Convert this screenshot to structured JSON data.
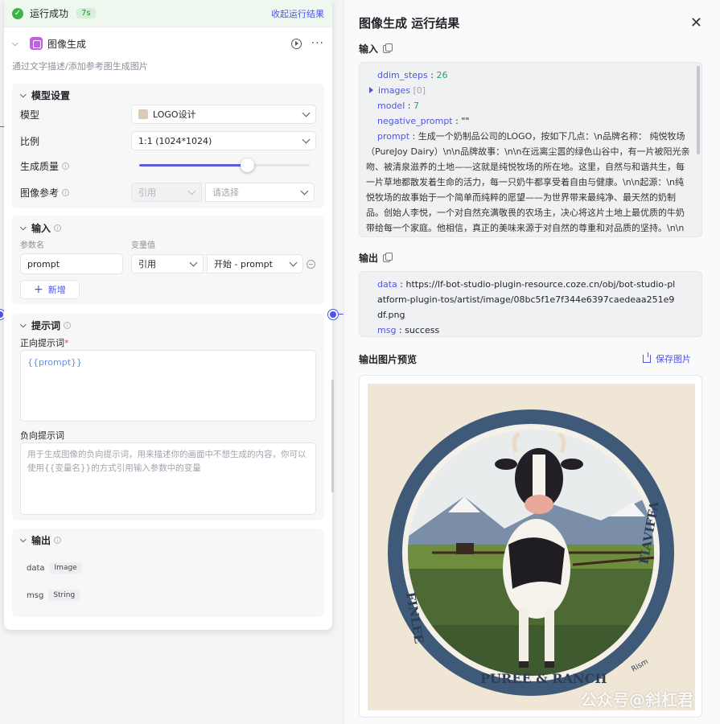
{
  "run_status": {
    "text": "运行成功",
    "time": "7s",
    "collapse_link": "收起运行结果"
  },
  "node": {
    "title": "图像生成",
    "description": "通过文字描述/添加参考图生成图片"
  },
  "model_settings": {
    "title": "模型设置",
    "model_label": "模型",
    "model_value": "LOGO设计",
    "ratio_label": "比例",
    "ratio_value": "1:1 (1024*1024)",
    "quality_label": "生成质量",
    "quality_level": 0.63,
    "ref_label": "图像参考",
    "ref_type": "引用",
    "ref_placeholder": "请选择"
  },
  "inputs": {
    "title": "输入",
    "param_header": "参数名",
    "var_header": "变量值",
    "param_name": "prompt",
    "ref_type": "引用",
    "ref_value": "开始 - prompt",
    "add_label": "新增"
  },
  "prompts": {
    "title": "提示词",
    "positive_label": "正向提示词",
    "positive_required": "*",
    "positive_value": "{{prompt}}",
    "negative_label": "负向提示词",
    "negative_placeholder": "用于生成图像的负向提示词，用来描述你的画面中不想生成的内容，你可以使用{{变量名}}的方式引用输入参数中的变量"
  },
  "outputs": {
    "title": "输出",
    "items": [
      {
        "name": "data",
        "type": "Image"
      },
      {
        "name": "msg",
        "type": "String"
      }
    ]
  },
  "result": {
    "title": "图像生成 运行结果",
    "input_label": "输入",
    "input_json": {
      "ddim_steps_key": "ddim_steps",
      "ddim_steps_val": "26",
      "images_key": "images",
      "images_count": "[0]",
      "model_key": "model",
      "model_val": "7",
      "negative_prompt_key": "negative_prompt",
      "negative_prompt_val": "\"\"",
      "prompt_key": "prompt",
      "prompt_val": "生成一个奶制品公司的LOGO，按如下几点：\\n品牌名称： 纯悦牧场（PureJoy Dairy）\\n\\n品牌故事：\\n\\n在远离尘嚣的绿色山谷中，有一片被阳光亲吻、被清泉滋养的土地——这就是纯悦牧场的所在地。这里，自然与和谐共生，每一片草地都散发着生命的活力，每一只奶牛都享受着自由与健康。\\n\\n起源：\\n纯悦牧场的故事始于一个简单而纯粹的愿望——为世界带来最纯净、最天然的奶制品。创始人李悦，一个对自然充满敬畏的农场主，决心将这片土地上最优质的牛奶带给每一个家庭。他相信，真正的美味来源于对自然的尊重和对品质的坚持。\\n\\n理念：\\n我们坚持“自然滋养，健康生活”的品牌理念。在纯悦牧场，我们用心呵护每一头奶牛，让它们在最适宜的环境中自由生长。"
    },
    "output_label": "输出",
    "output_json": {
      "data_key": "data",
      "data_val": "https://lf-bot-studio-plugin-resource.coze.cn/obj/bot-studio-platform-plugin-tos/artist/image/08bc5f1e7f344e6397caedeaa251e9df.png",
      "msg_key": "msg",
      "msg_val": "success"
    },
    "preview_label": "输出图片预览",
    "save_label": "保存图片",
    "logo_left_text": "FINLEE",
    "logo_right_text": "FIAVIFFA",
    "logo_bottom_text": "PUREE & RANCH",
    "logo_signature": "Rism",
    "watermark": "公众号@斜杠君"
  },
  "colors": {
    "accent": "#4e54e8",
    "success": "#3bb346"
  }
}
